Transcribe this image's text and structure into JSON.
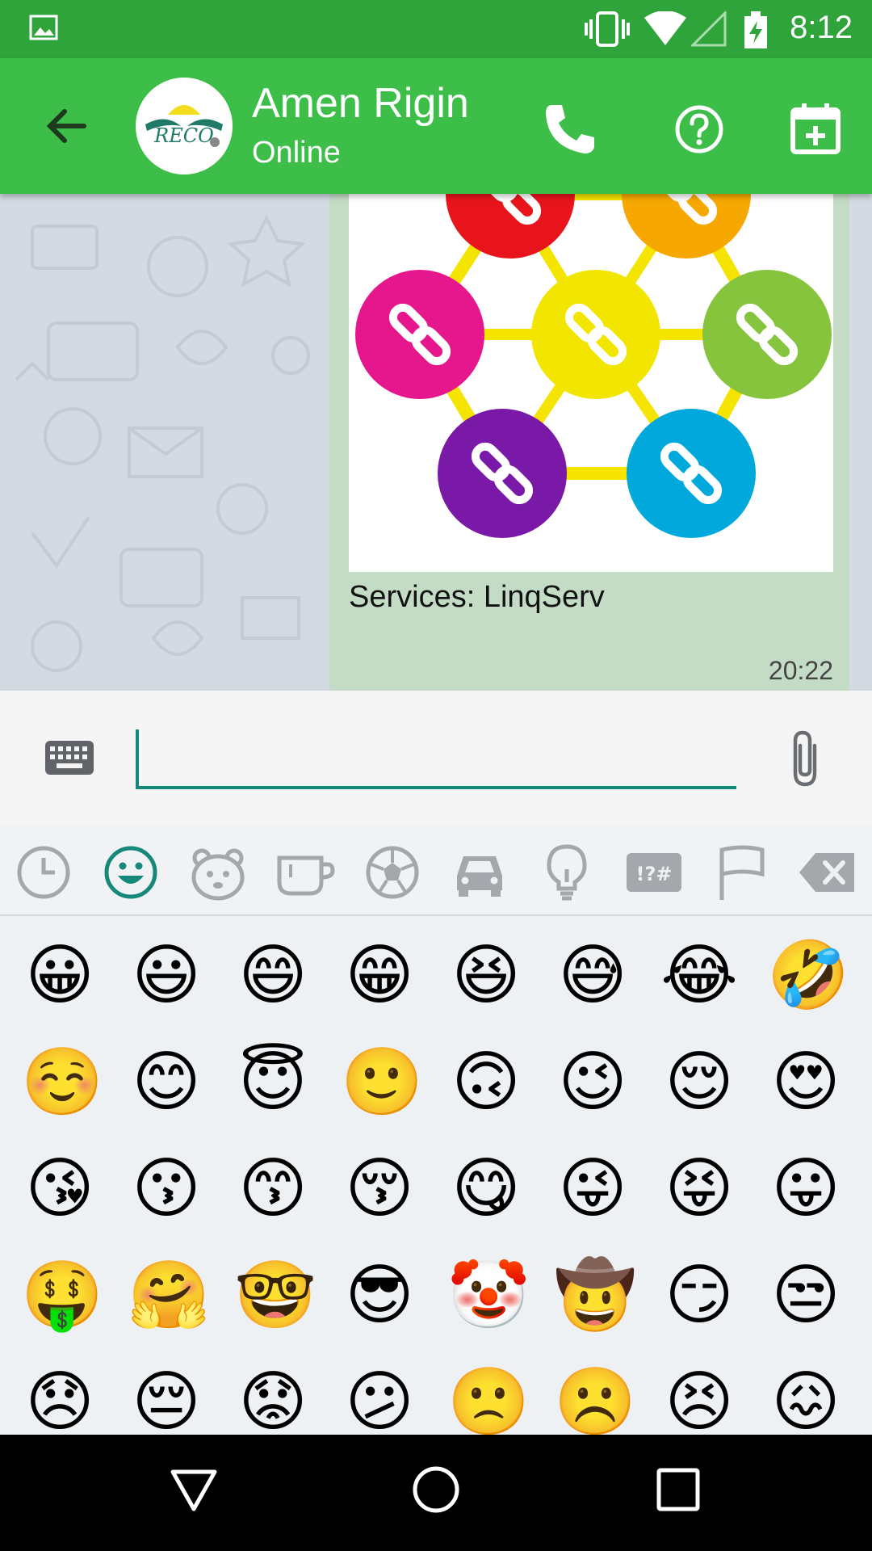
{
  "status_bar": {
    "time": "8:12"
  },
  "header": {
    "contact_name": "Amen Rigin",
    "contact_status": "Online",
    "avatar_text": "RECO"
  },
  "message": {
    "caption": "Services: LinqServ",
    "time": "20:22",
    "image_circle_colors": [
      "#e8141c",
      "#f7a800",
      "#e6168c",
      "#f2e600",
      "#86c43d",
      "#7a18a8",
      "#00a8dc"
    ],
    "image_network_color": "#f4e400"
  },
  "composer": {
    "value": "",
    "placeholder": ""
  },
  "emoji_tabs": [
    "recent-icon",
    "smileys-icon",
    "animals-icon",
    "food-icon",
    "sports-icon",
    "travel-icon",
    "objects-icon",
    "symbols-icon",
    "flags-icon",
    "backspace-icon"
  ],
  "emoji_rows": [
    [
      "😀",
      "😃",
      "😄",
      "😁",
      "😆",
      "😅",
      "😂",
      "🤣"
    ],
    [
      "☺️",
      "😊",
      "😇",
      "🙂",
      "🙃",
      "😉",
      "😌",
      "😍"
    ],
    [
      "😘",
      "😗",
      "😙",
      "😚",
      "😋",
      "😜",
      "😝",
      "😛"
    ],
    [
      "🤑",
      "🤗",
      "🤓",
      "😎",
      "🤡",
      "🤠",
      "😏",
      "😒"
    ],
    [
      "😞",
      "😔",
      "😟",
      "😕",
      "🙁",
      "☹️",
      "😣",
      "😖"
    ]
  ],
  "colors": {
    "status_bar": "#2ea43a",
    "app_bar": "#3cbe48",
    "bubble": "#c4dcc6",
    "accent": "#16887a",
    "active_tab": "#16887a"
  }
}
